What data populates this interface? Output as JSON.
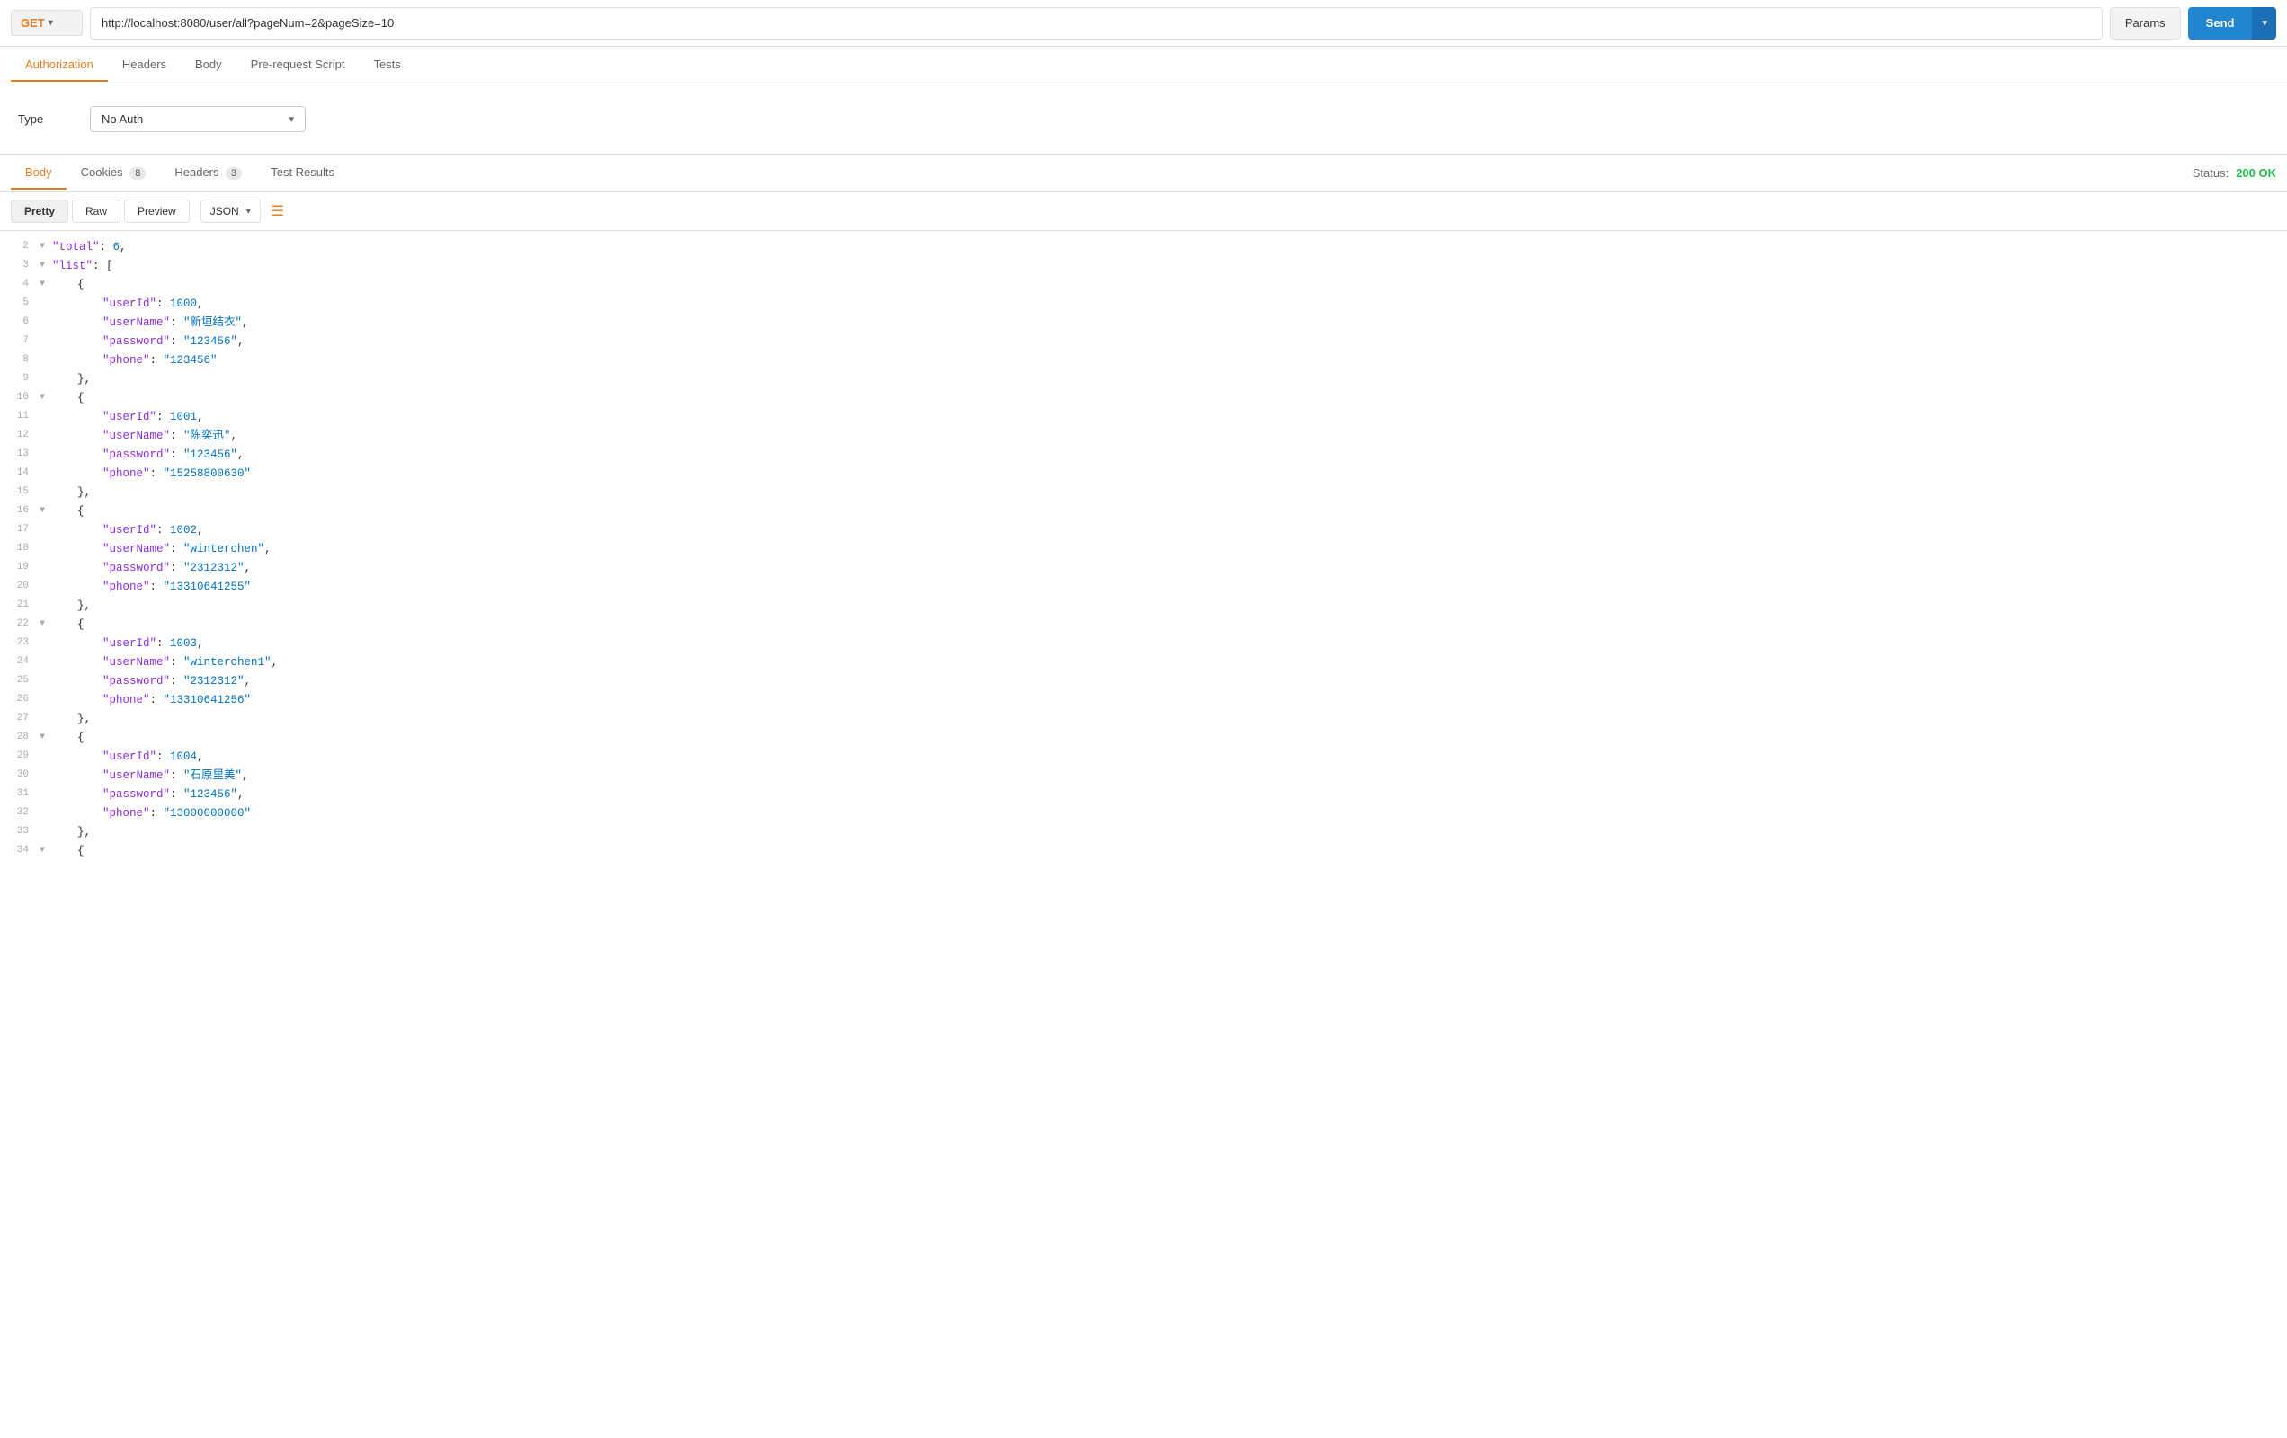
{
  "topbar": {
    "method": "GET",
    "url": "http://localhost:8080/user/all?pageNum=2&pageSize=10",
    "params_label": "Params",
    "send_label": "Send"
  },
  "request_tabs": [
    {
      "id": "authorization",
      "label": "Authorization",
      "active": true
    },
    {
      "id": "headers",
      "label": "Headers",
      "active": false
    },
    {
      "id": "body",
      "label": "Body",
      "active": false
    },
    {
      "id": "pre-request-script",
      "label": "Pre-request Script",
      "active": false
    },
    {
      "id": "tests",
      "label": "Tests",
      "active": false
    }
  ],
  "auth": {
    "type_label": "Type",
    "value": "No Auth"
  },
  "response_tabs": [
    {
      "id": "body",
      "label": "Body",
      "active": true,
      "badge": null
    },
    {
      "id": "cookies",
      "label": "Cookies",
      "active": false,
      "badge": "8"
    },
    {
      "id": "headers",
      "label": "Headers",
      "active": false,
      "badge": "3"
    },
    {
      "id": "test-results",
      "label": "Test Results",
      "active": false,
      "badge": null
    }
  ],
  "status": {
    "label": "Status:",
    "code": "200 OK"
  },
  "body_toolbar": {
    "views": [
      "Pretty",
      "Raw",
      "Preview"
    ],
    "active_view": "Pretty",
    "format": "JSON"
  },
  "json_lines": [
    {
      "num": 2,
      "arrow": "▼",
      "content": [
        {
          "type": "key",
          "text": "\"total\""
        },
        {
          "type": "punct",
          "text": ": "
        },
        {
          "type": "num",
          "text": "6"
        },
        {
          "type": "punct",
          "text": ","
        }
      ]
    },
    {
      "num": 3,
      "arrow": "▼",
      "content": [
        {
          "type": "key",
          "text": "\"list\""
        },
        {
          "type": "punct",
          "text": ": ["
        }
      ]
    },
    {
      "num": 4,
      "arrow": "▼",
      "content": [
        {
          "type": "punct",
          "text": "{"
        }
      ]
    },
    {
      "num": 5,
      "arrow": "",
      "content": [
        {
          "type": "key",
          "text": "\"userId\""
        },
        {
          "type": "punct",
          "text": ": "
        },
        {
          "type": "num",
          "text": "1000"
        },
        {
          "type": "punct",
          "text": ","
        }
      ]
    },
    {
      "num": 6,
      "arrow": "",
      "content": [
        {
          "type": "key",
          "text": "\"userName\""
        },
        {
          "type": "punct",
          "text": ": "
        },
        {
          "type": "str",
          "text": "\"新垣结衣\""
        },
        {
          "type": "punct",
          "text": ","
        }
      ]
    },
    {
      "num": 7,
      "arrow": "",
      "content": [
        {
          "type": "key",
          "text": "\"password\""
        },
        {
          "type": "punct",
          "text": ": "
        },
        {
          "type": "str",
          "text": "\"123456\""
        },
        {
          "type": "punct",
          "text": ","
        }
      ]
    },
    {
      "num": 8,
      "arrow": "",
      "content": [
        {
          "type": "key",
          "text": "\"phone\""
        },
        {
          "type": "punct",
          "text": ": "
        },
        {
          "type": "str",
          "text": "\"123456\""
        }
      ]
    },
    {
      "num": 9,
      "arrow": "",
      "content": [
        {
          "type": "punct",
          "text": "},"
        }
      ]
    },
    {
      "num": 10,
      "arrow": "▼",
      "content": [
        {
          "type": "punct",
          "text": "{"
        }
      ]
    },
    {
      "num": 11,
      "arrow": "",
      "content": [
        {
          "type": "key",
          "text": "\"userId\""
        },
        {
          "type": "punct",
          "text": ": "
        },
        {
          "type": "num",
          "text": "1001"
        },
        {
          "type": "punct",
          "text": ","
        }
      ]
    },
    {
      "num": 12,
      "arrow": "",
      "content": [
        {
          "type": "key",
          "text": "\"userName\""
        },
        {
          "type": "punct",
          "text": ": "
        },
        {
          "type": "str",
          "text": "\"陈奕迅\""
        },
        {
          "type": "punct",
          "text": ","
        }
      ]
    },
    {
      "num": 13,
      "arrow": "",
      "content": [
        {
          "type": "key",
          "text": "\"password\""
        },
        {
          "type": "punct",
          "text": ": "
        },
        {
          "type": "str",
          "text": "\"123456\""
        },
        {
          "type": "punct",
          "text": ","
        }
      ]
    },
    {
      "num": 14,
      "arrow": "",
      "content": [
        {
          "type": "key",
          "text": "\"phone\""
        },
        {
          "type": "punct",
          "text": ": "
        },
        {
          "type": "str",
          "text": "\"15258800630\""
        }
      ]
    },
    {
      "num": 15,
      "arrow": "",
      "content": [
        {
          "type": "punct",
          "text": "},"
        }
      ]
    },
    {
      "num": 16,
      "arrow": "▼",
      "content": [
        {
          "type": "punct",
          "text": "{"
        }
      ]
    },
    {
      "num": 17,
      "arrow": "",
      "content": [
        {
          "type": "key",
          "text": "\"userId\""
        },
        {
          "type": "punct",
          "text": ": "
        },
        {
          "type": "num",
          "text": "1002"
        },
        {
          "type": "punct",
          "text": ","
        }
      ]
    },
    {
      "num": 18,
      "arrow": "",
      "content": [
        {
          "type": "key",
          "text": "\"userName\""
        },
        {
          "type": "punct",
          "text": ": "
        },
        {
          "type": "str",
          "text": "\"winterchen\""
        },
        {
          "type": "punct",
          "text": ","
        }
      ]
    },
    {
      "num": 19,
      "arrow": "",
      "content": [
        {
          "type": "key",
          "text": "\"password\""
        },
        {
          "type": "punct",
          "text": ": "
        },
        {
          "type": "str",
          "text": "\"2312312\""
        },
        {
          "type": "punct",
          "text": ","
        }
      ]
    },
    {
      "num": 20,
      "arrow": "",
      "content": [
        {
          "type": "key",
          "text": "\"phone\""
        },
        {
          "type": "punct",
          "text": ": "
        },
        {
          "type": "str",
          "text": "\"13310641255\""
        }
      ]
    },
    {
      "num": 21,
      "arrow": "",
      "content": [
        {
          "type": "punct",
          "text": "},"
        }
      ]
    },
    {
      "num": 22,
      "arrow": "▼",
      "content": [
        {
          "type": "punct",
          "text": "{"
        }
      ]
    },
    {
      "num": 23,
      "arrow": "",
      "content": [
        {
          "type": "key",
          "text": "\"userId\""
        },
        {
          "type": "punct",
          "text": ": "
        },
        {
          "type": "num",
          "text": "1003"
        },
        {
          "type": "punct",
          "text": ","
        }
      ]
    },
    {
      "num": 24,
      "arrow": "",
      "content": [
        {
          "type": "key",
          "text": "\"userName\""
        },
        {
          "type": "punct",
          "text": ": "
        },
        {
          "type": "str",
          "text": "\"winterchen1\""
        },
        {
          "type": "punct",
          "text": ","
        }
      ]
    },
    {
      "num": 25,
      "arrow": "",
      "content": [
        {
          "type": "key",
          "text": "\"password\""
        },
        {
          "type": "punct",
          "text": ": "
        },
        {
          "type": "str",
          "text": "\"2312312\""
        },
        {
          "type": "punct",
          "text": ","
        }
      ]
    },
    {
      "num": 26,
      "arrow": "",
      "content": [
        {
          "type": "key",
          "text": "\"phone\""
        },
        {
          "type": "punct",
          "text": ": "
        },
        {
          "type": "str",
          "text": "\"13310641256\""
        }
      ]
    },
    {
      "num": 27,
      "arrow": "",
      "content": [
        {
          "type": "punct",
          "text": "},"
        }
      ]
    },
    {
      "num": 28,
      "arrow": "▼",
      "content": [
        {
          "type": "punct",
          "text": "{"
        }
      ]
    },
    {
      "num": 29,
      "arrow": "",
      "content": [
        {
          "type": "key",
          "text": "\"userId\""
        },
        {
          "type": "punct",
          "text": ": "
        },
        {
          "type": "num",
          "text": "1004"
        },
        {
          "type": "punct",
          "text": ","
        }
      ]
    },
    {
      "num": 30,
      "arrow": "",
      "content": [
        {
          "type": "key",
          "text": "\"userName\""
        },
        {
          "type": "punct",
          "text": ": "
        },
        {
          "type": "str",
          "text": "\"石原里美\""
        },
        {
          "type": "punct",
          "text": ","
        }
      ]
    },
    {
      "num": 31,
      "arrow": "",
      "content": [
        {
          "type": "key",
          "text": "\"password\""
        },
        {
          "type": "punct",
          "text": ": "
        },
        {
          "type": "str",
          "text": "\"123456\""
        },
        {
          "type": "punct",
          "text": ","
        }
      ]
    },
    {
      "num": 32,
      "arrow": "",
      "content": [
        {
          "type": "key",
          "text": "\"phone\""
        },
        {
          "type": "punct",
          "text": ": "
        },
        {
          "type": "str",
          "text": "\"13000000000\""
        }
      ]
    },
    {
      "num": 33,
      "arrow": "",
      "content": [
        {
          "type": "punct",
          "text": "},"
        }
      ]
    },
    {
      "num": 34,
      "arrow": "▼",
      "content": [
        {
          "type": "punct",
          "text": "{"
        }
      ]
    }
  ]
}
